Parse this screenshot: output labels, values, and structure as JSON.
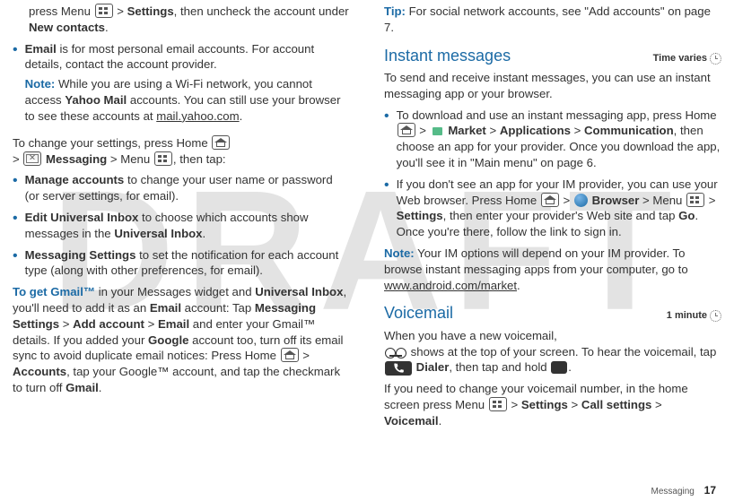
{
  "watermark": "DRAFT",
  "left": {
    "topline": {
      "a": "press Menu",
      "b": " > ",
      "c": "Settings",
      "d": ", then uncheck the account under ",
      "e": "New contacts",
      "f": "."
    },
    "b1": {
      "lead": "Email",
      "t1": " is for most personal email accounts. For account details, contact the account provider.",
      "noteLabel": "Note:",
      "noteBody": " While you are using a Wi-Fi network, you cannot access ",
      "ym": "Yahoo Mail",
      "noteBody2": " accounts. You can still use your browser to see these accounts at ",
      "link": "mail.yahoo.com",
      "noteBody3": "."
    },
    "changeLine": {
      "a": "To change your settings, press Home",
      "b": " > ",
      "c": "Messaging",
      "d": " > Menu",
      "e": ", then tap:"
    },
    "b2": {
      "lead": "Manage accounts",
      "body": " to change your user name or password (or server settings, for email)."
    },
    "b3": {
      "lead": "Edit Universal Inbox",
      "mid": " to choose which accounts show messages in the ",
      "tail": "Universal Inbox",
      "end": "."
    },
    "b4": {
      "lead": "Messaging Settings",
      "body": " to set the notification for each account type (along with other preferences, for email)."
    },
    "gmail": {
      "link": "To get Gmail™",
      "a": " in your Messages widget and ",
      "ui": "Universal Inbox",
      "b": ", you'll need to add it as an ",
      "em": "Email",
      "c": " account: Tap ",
      "ms": "Messaging Settings",
      "d": " > ",
      "aa": "Add account",
      "e": " > ",
      "em2": "Email",
      "f": " and enter your Gmail™ details. If you added your ",
      "g": "Google",
      "h": " account too, turn off its email sync to avoid duplicate email notices: Press Home",
      "i": " > ",
      "acc": "Accounts",
      "j": ", tap your Google™ account, and tap the checkmark to turn off ",
      "gm": "Gmail",
      "k": "."
    }
  },
  "right": {
    "tip": {
      "label": "Tip:",
      "body": " For social network accounts, see \"Add accounts\" on page 7."
    },
    "imHead": "Instant messages",
    "imTime": "Time varies",
    "imIntro": "To send and receive instant messages, you can use an instant messaging app or your browser.",
    "imB1": {
      "a": "To download and use an instant messaging app, press Home",
      "b": " > ",
      "mk": "Market",
      "c": " > ",
      "ap": "Applications",
      "d": " > ",
      "cm": "Communication",
      "e": ", then choose an app for your provider. Once you download the app, you'll see it in \"Main menu\" on page 6."
    },
    "imB2": {
      "a": "If you don't see an app for your IM provider, you can use your Web browser. Press Home",
      "b": " > ",
      "br": "Browser",
      "c": " > Menu",
      "d": " > ",
      "st": "Settings",
      "e": ", then enter your provider's Web site and tap ",
      "go": "Go",
      "f": ". Once you're there, follow the link to sign in."
    },
    "imNote": {
      "label": "Note:",
      "a": " Your IM options will depend on your IM provider. To browse instant messaging apps from your computer, go to ",
      "link": "www.android.com/market",
      "b": "."
    },
    "vmHead": "Voicemail",
    "vmTime": "1 minute",
    "vm1": {
      "a": "When you have a new voicemail,",
      "b": " shows at the top of your screen. To hear the voicemail, tap ",
      "dl": "Dialer",
      "c": ", then tap and hold ",
      "one": "1",
      "d": "."
    },
    "vm2": {
      "a": "If you need to change your voicemail number, in the home screen press Menu",
      "b": " > ",
      "st": "Settings",
      "c": " > ",
      "cs": "Call settings",
      "d": " > ",
      "vmi": "Voicemail",
      "e": "."
    }
  },
  "footer": {
    "section": "Messaging",
    "page": "17"
  }
}
